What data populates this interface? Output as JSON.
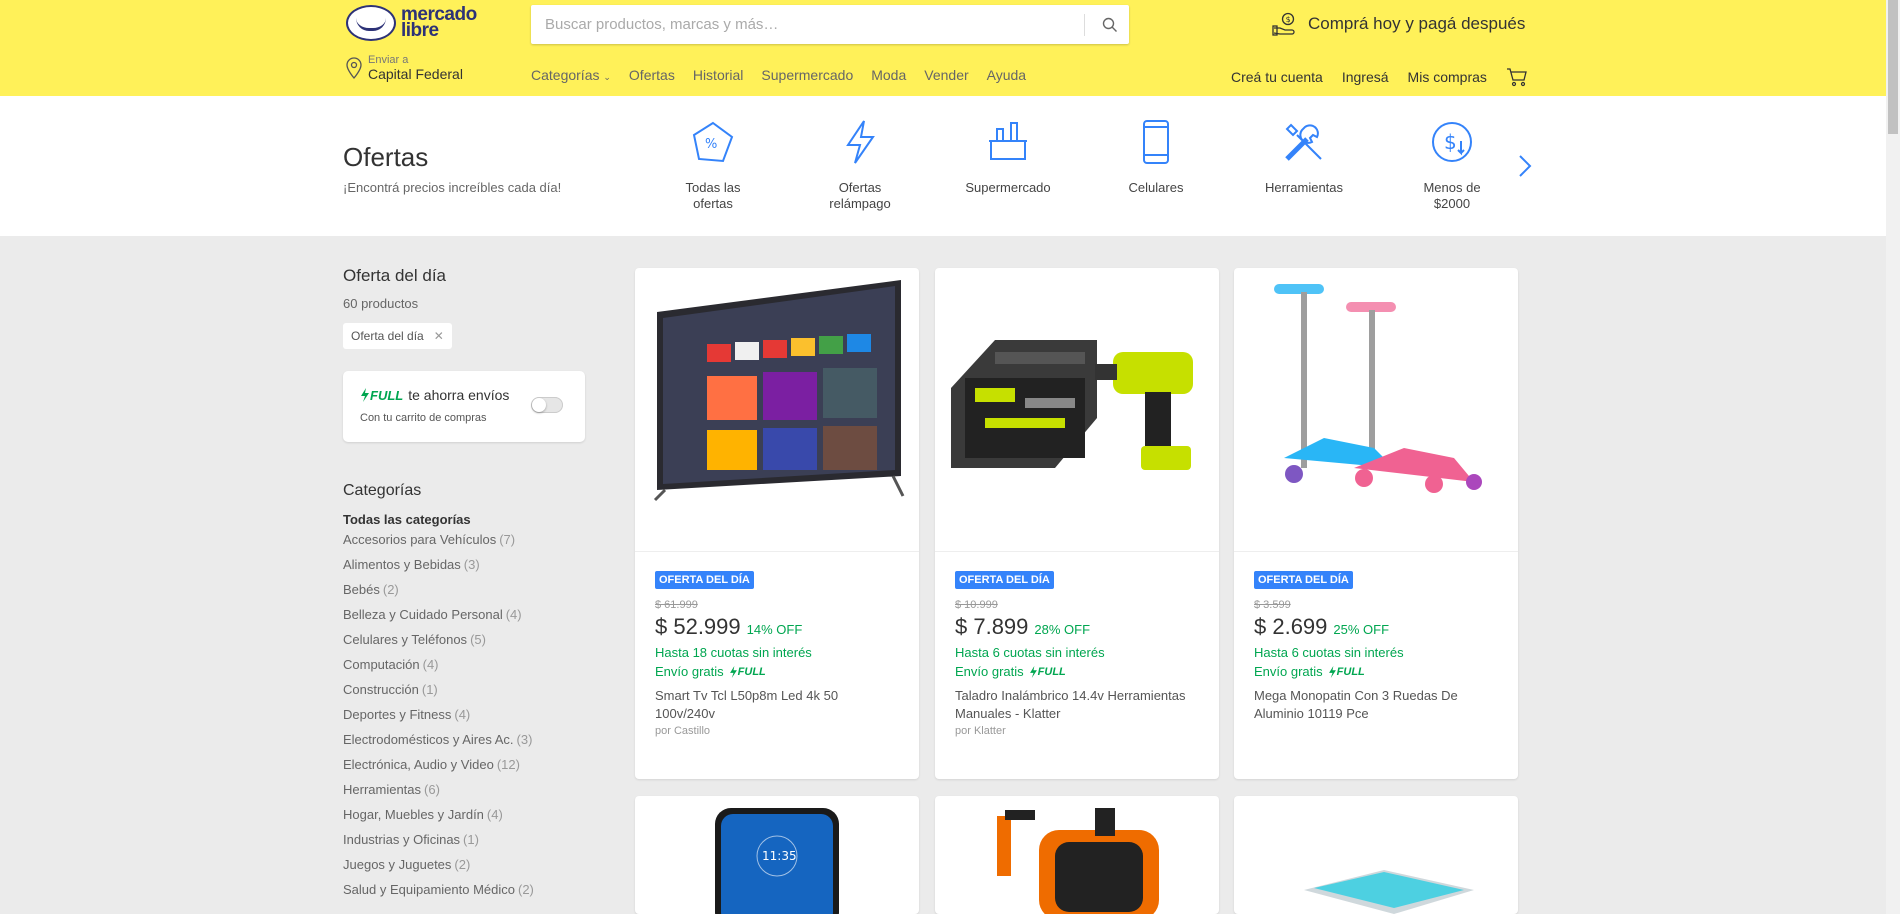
{
  "header": {
    "logo_line1": "mercado",
    "logo_line2": "libre",
    "search_placeholder": "Buscar productos, marcas y más…",
    "promo_text": "Comprá hoy y pagá después",
    "location_label": "Enviar a",
    "location_value": "Capital Federal",
    "nav": [
      "Categorías",
      "Ofertas",
      "Historial",
      "Supermercado",
      "Moda",
      "Vender",
      "Ayuda"
    ],
    "user_nav": [
      "Creá tu cuenta",
      "Ingresá",
      "Mis compras"
    ]
  },
  "offers": {
    "title": "Ofertas",
    "subtitle": "¡Encontrá precios increíbles cada día!",
    "categories": [
      {
        "label": "Todas las ofertas",
        "icon": "percent-tag-icon"
      },
      {
        "label": "Ofertas relámpago",
        "icon": "lightning-icon"
      },
      {
        "label": "Supermercado",
        "icon": "shopping-basket-icon"
      },
      {
        "label": "Celulares",
        "icon": "phone-icon"
      },
      {
        "label": "Herramientas",
        "icon": "tools-icon"
      },
      {
        "label": "Menos de $2000",
        "icon": "dollar-coin-icon"
      }
    ]
  },
  "sidebar": {
    "title": "Oferta del día",
    "count": "60 productos",
    "chip": "Oferta del día",
    "full_label": "FULL",
    "full_text": "te ahorra envíos",
    "full_sub": "Con tu carrito de compras",
    "categories_title": "Categorías",
    "all_categories": "Todas las categorías",
    "categories": [
      {
        "name": "Accesorios para Vehículos",
        "count": "(7)"
      },
      {
        "name": "Alimentos y Bebidas",
        "count": "(3)"
      },
      {
        "name": "Bebés",
        "count": "(2)"
      },
      {
        "name": "Belleza y Cuidado Personal",
        "count": "(4)"
      },
      {
        "name": "Celulares y Teléfonos",
        "count": "(5)"
      },
      {
        "name": "Computación",
        "count": "(4)"
      },
      {
        "name": "Construcción",
        "count": "(1)"
      },
      {
        "name": "Deportes y Fitness",
        "count": "(4)"
      },
      {
        "name": "Electrodomésticos y Aires Ac.",
        "count": "(3)"
      },
      {
        "name": "Electrónica, Audio y Video",
        "count": "(12)"
      },
      {
        "name": "Herramientas",
        "count": "(6)"
      },
      {
        "name": "Hogar, Muebles y Jardín",
        "count": "(4)"
      },
      {
        "name": "Industrias y Oficinas",
        "count": "(1)"
      },
      {
        "name": "Juegos y Juguetes",
        "count": "(2)"
      },
      {
        "name": "Salud y Equipamiento Médico",
        "count": "(2)"
      }
    ]
  },
  "products": [
    {
      "badge": "OFERTA DEL DÍA",
      "old_price": "$ 61.999",
      "price": "$ 52.999",
      "off": "14% OFF",
      "installments": "Hasta 18 cuotas sin interés",
      "shipping": "Envío gratis",
      "full": "FULL",
      "title": "Smart Tv Tcl L50p8m Led 4k 50 100v/240v",
      "seller": "por Castillo"
    },
    {
      "badge": "OFERTA DEL DÍA",
      "old_price": "$ 10.999",
      "price": "$ 7.899",
      "off": "28% OFF",
      "installments": "Hasta 6 cuotas sin interés",
      "shipping": "Envío gratis",
      "full": "FULL",
      "title": "Taladro Inalámbrico 14.4v Herramientas Manuales - Klatter",
      "seller": "por Klatter"
    },
    {
      "badge": "OFERTA DEL DÍA",
      "old_price": "$ 3.599",
      "price": "$ 2.699",
      "off": "25% OFF",
      "installments": "Hasta 6 cuotas sin interés",
      "shipping": "Envío gratis",
      "full": "FULL",
      "title": "Mega Monopatin Con 3 Ruedas De Aluminio 10119 Pce",
      "seller": ""
    }
  ],
  "phone_screen_time": "11:35",
  "colors": {
    "header_bg": "#fff159",
    "accent_blue": "#3483fa",
    "green": "#00a650",
    "brand_navy": "#2d3277"
  }
}
